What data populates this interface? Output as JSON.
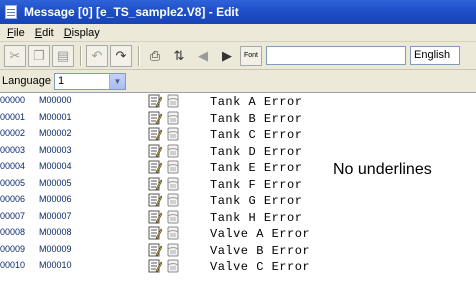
{
  "window": {
    "title": "Message [0] [e_TS_sample2.V8] - Edit"
  },
  "menu": [
    {
      "label": "File",
      "first": "F",
      "rest": "ile"
    },
    {
      "label": "Edit",
      "first": "E",
      "rest": "dit"
    },
    {
      "label": "Display",
      "first": "D",
      "rest": "isplay"
    }
  ],
  "toolbar": {
    "font_label": "Font",
    "text_value": "",
    "language_name": "English"
  },
  "language_bar": {
    "label": "Language",
    "selected": "1"
  },
  "rows": [
    {
      "num": "00000",
      "id": "M00000",
      "text": "Tank A Error"
    },
    {
      "num": "00001",
      "id": "M00001",
      "text": "Tank B Error"
    },
    {
      "num": "00002",
      "id": "M00002",
      "text": "Tank C Error"
    },
    {
      "num": "00003",
      "id": "M00003",
      "text": "Tank D Error"
    },
    {
      "num": "00004",
      "id": "M00004",
      "text": "Tank E Error"
    },
    {
      "num": "00005",
      "id": "M00005",
      "text": "Tank F Error"
    },
    {
      "num": "00006",
      "id": "M00006",
      "text": "Tank G Error"
    },
    {
      "num": "00007",
      "id": "M00007",
      "text": "Tank H Error"
    },
    {
      "num": "00008",
      "id": "M00008",
      "text": "Valve A Error"
    },
    {
      "num": "00009",
      "id": "M00009",
      "text": "Valve B Error"
    },
    {
      "num": "00010",
      "id": "M00010",
      "text": "Valve C Error"
    }
  ],
  "annotation": "No underlines"
}
